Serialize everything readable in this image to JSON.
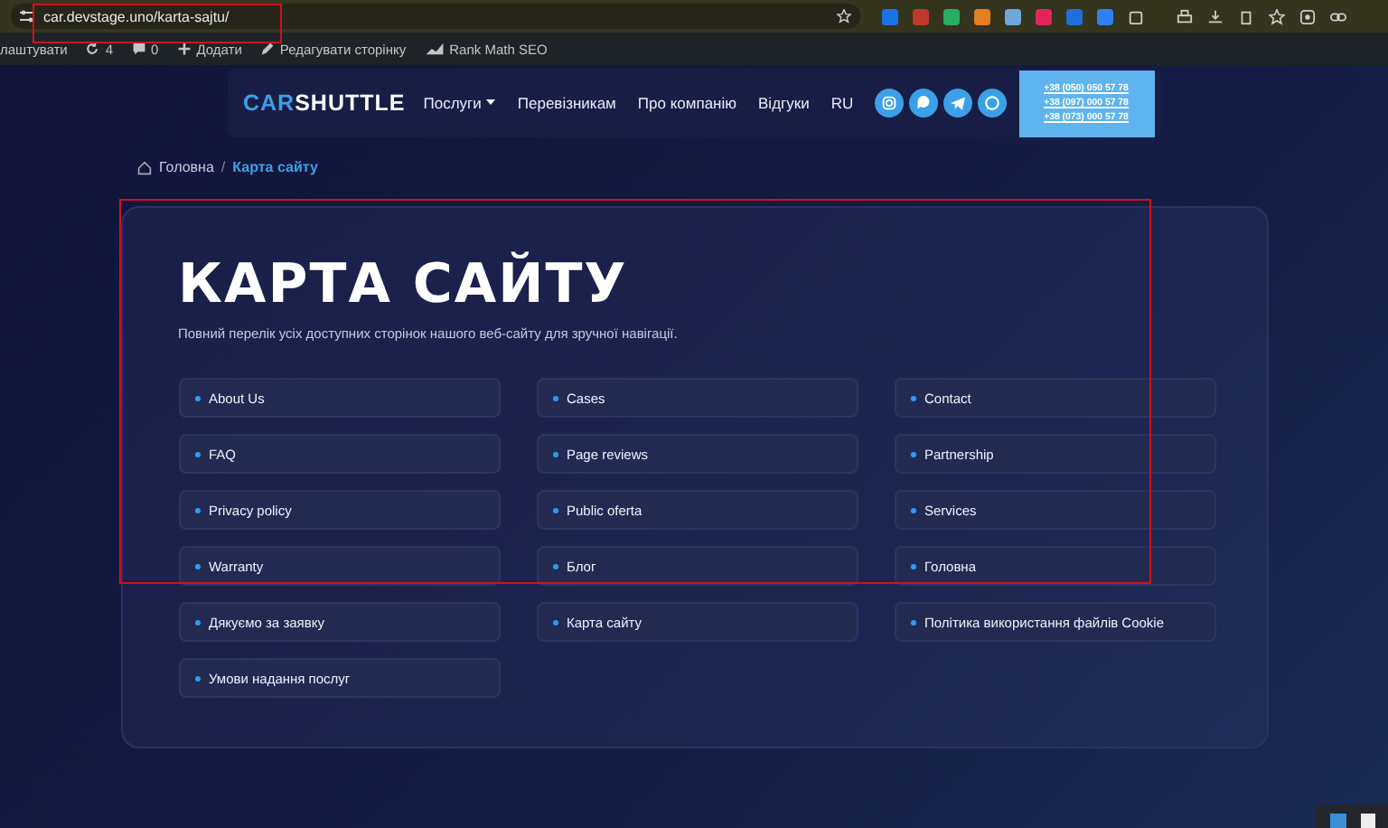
{
  "browser": {
    "url": "car.devstage.uno/karta-sajtu/"
  },
  "admin_bar": {
    "items": [
      {
        "kind": "text",
        "label": "лаштувати"
      },
      {
        "kind": "sync",
        "label": "4"
      },
      {
        "kind": "comment",
        "label": "0"
      },
      {
        "kind": "plus",
        "label": "Додати"
      },
      {
        "kind": "pencil",
        "label": "Редагувати сторінку"
      },
      {
        "kind": "chart",
        "label": "Rank Math SEO"
      }
    ]
  },
  "header": {
    "logo_a": "CAR",
    "logo_b": "SHUTTLE",
    "nav": [
      {
        "label": "Послуги",
        "dropdown": true
      },
      {
        "label": "Перевізникам",
        "dropdown": false
      },
      {
        "label": "Про компанію",
        "dropdown": false
      },
      {
        "label": "Відгуки",
        "dropdown": false
      },
      {
        "label": "RU",
        "dropdown": false
      }
    ],
    "social": [
      {
        "kind": "instagram"
      },
      {
        "kind": "viber"
      },
      {
        "kind": "telegram"
      },
      {
        "kind": "whatsapp"
      }
    ],
    "phones": [
      "+38 (050) 050 57 78",
      "+38 (097) 000 57 78",
      "+38 (073) 000 57 78"
    ]
  },
  "breadcrumb_separator": "/",
  "breadcrumb": [
    {
      "label": "Головна",
      "selected": false
    },
    {
      "label": "Карта сайту",
      "selected": true
    }
  ],
  "title": "КАРТА САЙТУ",
  "subtitle": "Повний перелік усіх доступних сторінок нашого веб-сайту для зручної навігації.",
  "links": [
    "About Us",
    "Cases",
    "Contact",
    "FAQ",
    "Page reviews",
    "Partnership",
    "Privacy policy",
    "Public oferta",
    "Services",
    "Warranty",
    "Блог",
    "Головна",
    "Дякуємо за заявку",
    "Карта сайту",
    "Політика використання файлів Cookie",
    "Умови надання послуг"
  ]
}
